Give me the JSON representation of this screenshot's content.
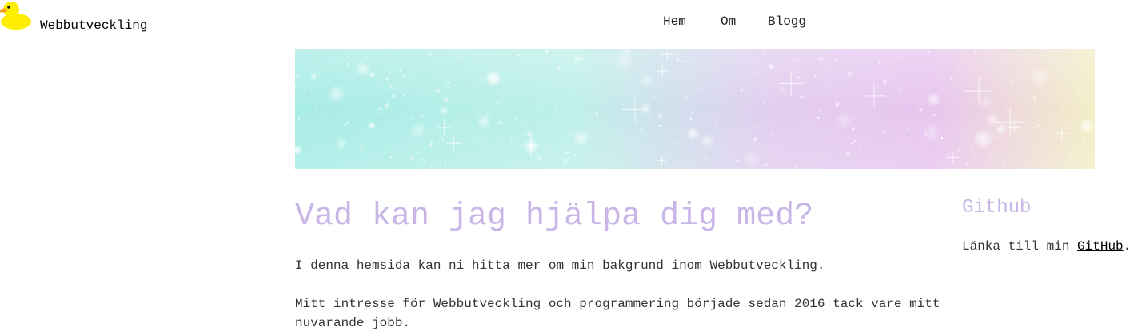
{
  "header": {
    "site_title": "Webbutveckling",
    "logo_icon": "rubber-duck-icon"
  },
  "nav": {
    "items": [
      {
        "label": "Hem"
      },
      {
        "label": "Om"
      },
      {
        "label": "Blogg"
      }
    ]
  },
  "banner": {
    "colors": [
      "#a8ece6",
      "#c9f1ea",
      "#e7c9ef",
      "#f6f1c4"
    ]
  },
  "main": {
    "heading": "Vad kan jag hjälpa dig med?",
    "paragraph_1": "I denna hemsida kan ni hitta mer om min bakgrund inom Webbutveckling.",
    "paragraph_2": "Mitt intresse för Webbutveckling och programmering började sedan 2016 tack vare mitt nuvarande jobb."
  },
  "sidebar": {
    "heading": "Github",
    "text_prefix": "Länka till min ",
    "link_label": "GitHub",
    "text_suffix": "."
  },
  "colors": {
    "heading": "#c7b6e6",
    "text": "#333333"
  }
}
